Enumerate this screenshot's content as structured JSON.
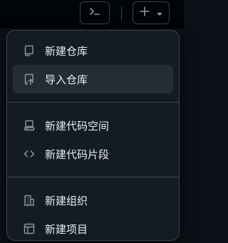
{
  "topbar": {
    "command_icon": "terminal-icon",
    "create_icon": "plus-icon",
    "create_dropdown_icon": "triangle-down-icon"
  },
  "menu": {
    "groups": [
      [
        {
          "label": "新建仓库",
          "icon": "repo-icon"
        },
        {
          "label": "导入仓库",
          "icon": "repo-push-icon",
          "active": true
        }
      ],
      [
        {
          "label": "新建代码空间",
          "icon": "codespaces-icon"
        },
        {
          "label": "新建代码片段",
          "icon": "code-icon"
        }
      ],
      [
        {
          "label": "新建组织",
          "icon": "organization-icon"
        },
        {
          "label": "新建项目",
          "icon": "table-icon"
        }
      ]
    ]
  },
  "colors": {
    "background": "#0d1117",
    "menu_bg": "#151b23",
    "border": "#3d444d",
    "active_bg": "#262c36",
    "text": "#e6edf3",
    "muted": "#9198a1"
  }
}
